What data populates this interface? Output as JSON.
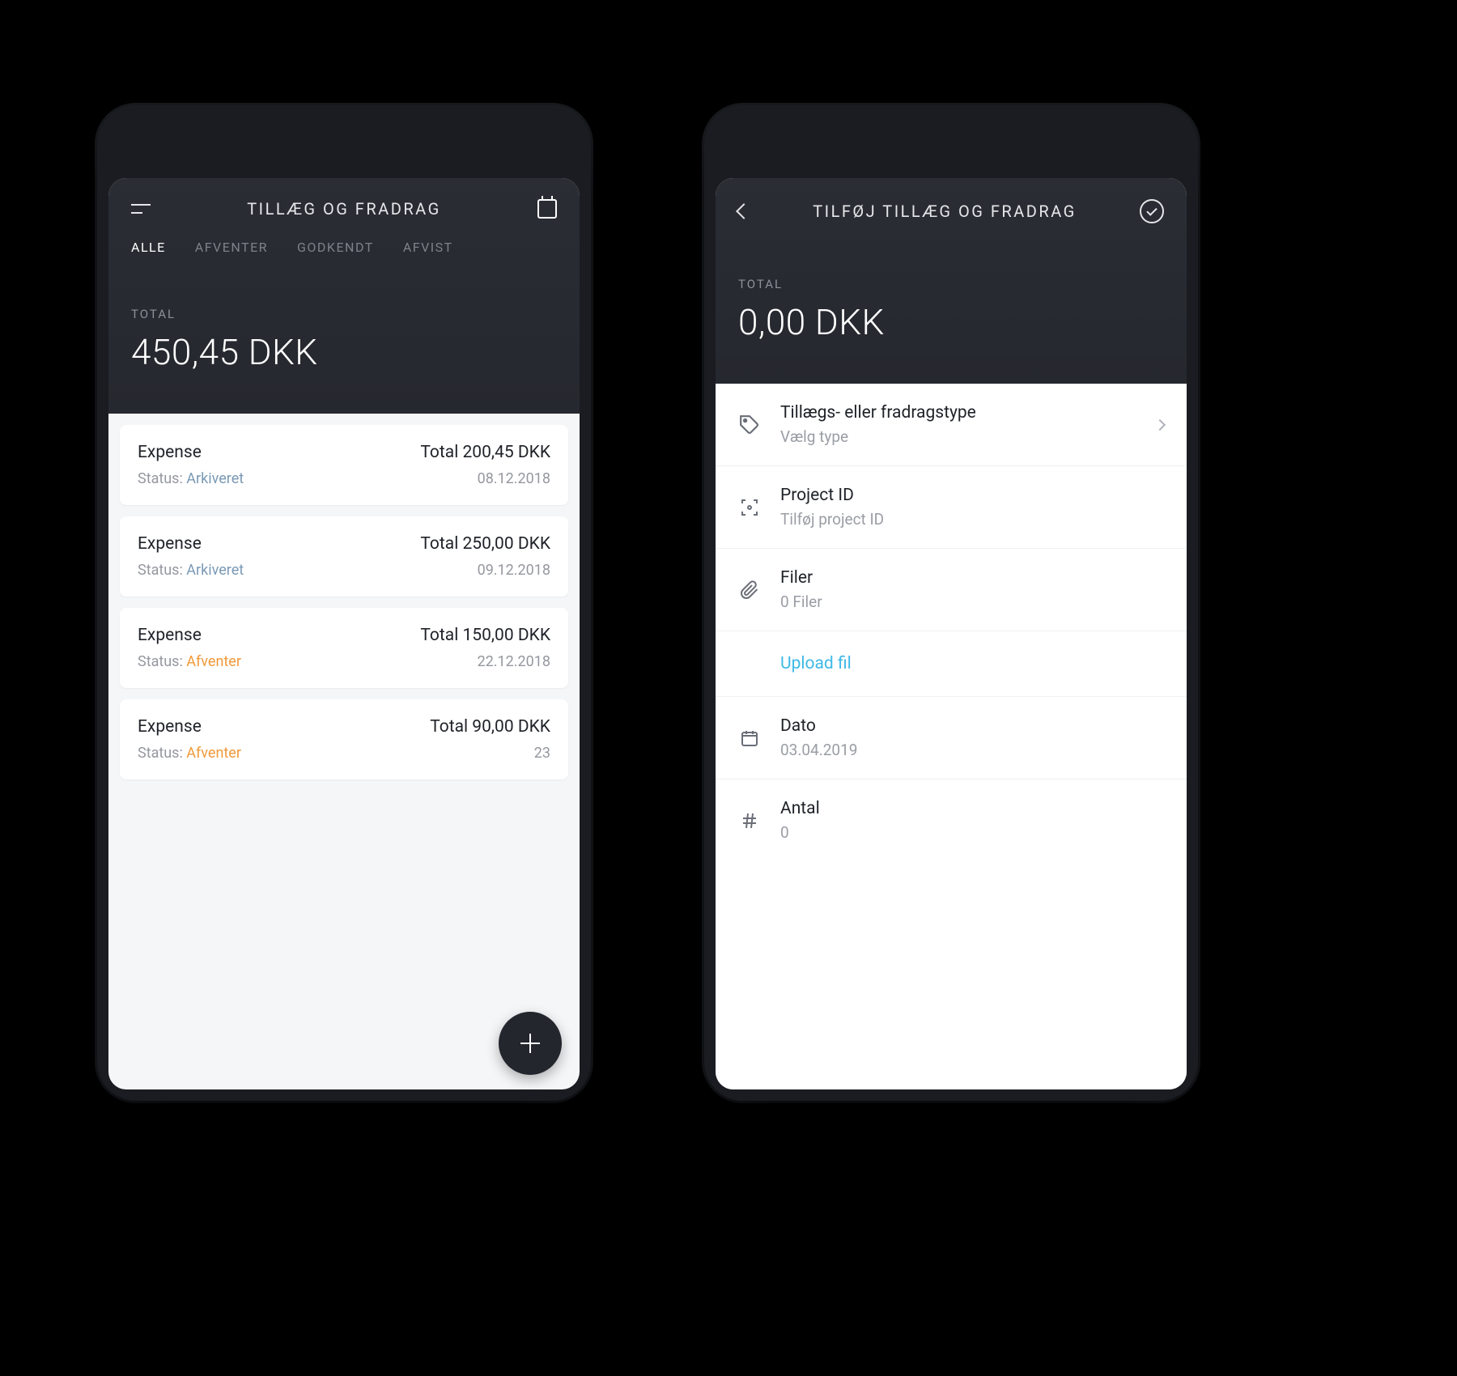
{
  "phone1": {
    "header_title": "TILLÆG OG FRADRAG",
    "tabs": [
      "ALLE",
      "AFVENTER",
      "GODKENDT",
      "AFVIST"
    ],
    "total_label": "TOTAL",
    "total_amount": "450,45 DKK",
    "items": [
      {
        "title": "Expense",
        "total": "Total 200,45 DKK",
        "status_label": "Status: ",
        "status": "Arkiveret",
        "status_class": "status-arkiveret",
        "date": "08.12.2018"
      },
      {
        "title": "Expense",
        "total": "Total 250,00 DKK",
        "status_label": "Status: ",
        "status": "Arkiveret",
        "status_class": "status-arkiveret",
        "date": "09.12.2018"
      },
      {
        "title": "Expense",
        "total": "Total 150,00 DKK",
        "status_label": "Status: ",
        "status": "Afventer",
        "status_class": "status-afventer",
        "date": "22.12.2018"
      },
      {
        "title": "Expense",
        "total": "Total 90,00 DKK",
        "status_label": "Status: ",
        "status": "Afventer",
        "status_class": "status-afventer",
        "date": "23"
      }
    ]
  },
  "phone2": {
    "header_title": "TILFØJ TILLÆG OG FRADRAG",
    "total_label": "TOTAL",
    "total_amount": "0,00 DKK",
    "rows": {
      "type": {
        "title": "Tillægs- eller fradragstype",
        "sub": "Vælg type"
      },
      "project": {
        "title": "Project ID",
        "sub": "Tilføj project ID"
      },
      "files": {
        "title": "Filer",
        "sub": "0 Filer"
      },
      "upload": "Upload fil",
      "date": {
        "title": "Dato",
        "sub": "03.04.2019"
      },
      "count": {
        "title": "Antal",
        "sub": "0"
      }
    }
  }
}
